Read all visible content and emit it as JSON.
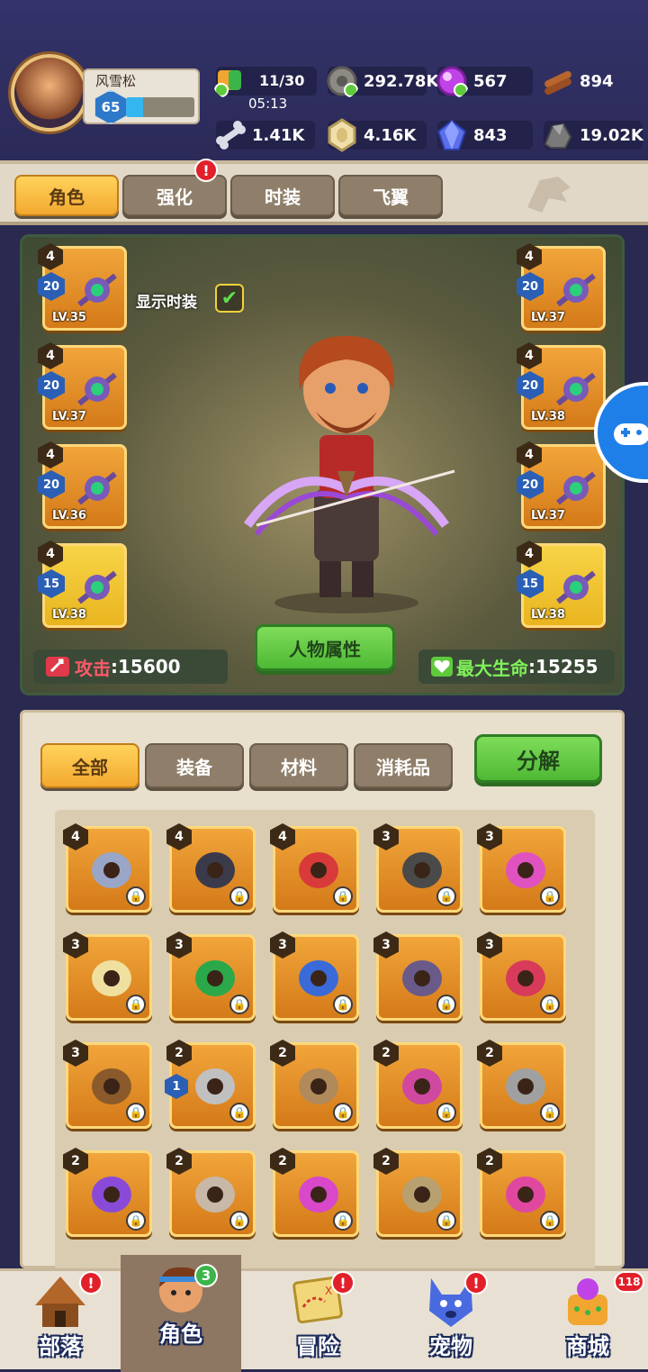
{
  "player": {
    "name": "风雪松",
    "level": "65",
    "xp_fraction": 0.25
  },
  "resources": {
    "stamina": {
      "value": "11/30",
      "timer": "05:13",
      "icon": "stamina-icon"
    },
    "stone_coin": {
      "value": "292.78K",
      "icon": "stone-coin-icon"
    },
    "gem": {
      "value": "567",
      "icon": "purple-orb-icon"
    },
    "wood": {
      "value": "894",
      "icon": "wood-icon"
    },
    "bone": {
      "value": "1.41K",
      "icon": "bone-icon"
    },
    "shell": {
      "value": "4.16K",
      "icon": "shell-icon"
    },
    "crystal": {
      "value": "843",
      "icon": "crystal-icon"
    },
    "ore": {
      "value": "19.02K",
      "icon": "ore-icon"
    }
  },
  "tabs": [
    "角色",
    "强化",
    "时装",
    "飞翼"
  ],
  "show_costume": {
    "label": "显示时装",
    "checked": true
  },
  "equipment_left": [
    {
      "tier": "4",
      "stars": "20",
      "level": "LV.35"
    },
    {
      "tier": "4",
      "stars": "20",
      "level": "LV.37"
    },
    {
      "tier": "4",
      "stars": "20",
      "level": "LV.36"
    },
    {
      "tier": "4",
      "stars": "15",
      "level": "LV.38"
    }
  ],
  "equipment_right": [
    {
      "tier": "4",
      "stars": "20",
      "level": "LV.37"
    },
    {
      "tier": "4",
      "stars": "20",
      "level": "LV.38"
    },
    {
      "tier": "4",
      "stars": "20",
      "level": "LV.37"
    },
    {
      "tier": "4",
      "stars": "15",
      "level": "LV.38"
    }
  ],
  "stats": {
    "attack_label": "攻击",
    "attack_value": ":15600",
    "hp_label": "最大生命",
    "hp_value": ":15255",
    "attributes_button": "人物属性"
  },
  "inventory": {
    "filters": [
      "全部",
      "装备",
      "材料",
      "消耗品"
    ],
    "decompose_button": "分解",
    "rows": [
      [
        "4",
        "4",
        "4",
        "3",
        "3"
      ],
      [
        "3",
        "3",
        "3",
        "3",
        "3"
      ],
      [
        "3",
        "2",
        "2",
        "2",
        "2"
      ],
      [
        "2",
        "2",
        "2",
        "2",
        "2"
      ]
    ],
    "item_icons": [
      [
        "trident-icon",
        "horned-helmet-icon",
        "amulet-icon",
        "spiked-armor-icon",
        "horn-icon"
      ],
      [
        "boots-icon",
        "green-ring-icon",
        "blue-ring-icon",
        "dark-ring-icon",
        "ruby-ring-icon"
      ],
      [
        "pendant-icon",
        "bow-icon",
        "spear-icon",
        "bat-armor-icon",
        "helmet-icon"
      ],
      [
        "cape-icon",
        "fur-armor-icon",
        "gauntlet-icon",
        "belt-icon",
        "shoe-icon"
      ]
    ],
    "secondary_badge": "1"
  },
  "nav": [
    {
      "label": "部落",
      "alert": "!"
    },
    {
      "label": "角色",
      "badge": "3"
    },
    {
      "label": "冒险",
      "alert": "!"
    },
    {
      "label": "宠物",
      "alert": "!"
    },
    {
      "label": "商城",
      "badge": "118"
    }
  ],
  "colors": {
    "accent": "#f3a92f",
    "panel": "#e8dfcc",
    "alert": "#e2202a",
    "green_button": "#5fcb3c"
  }
}
